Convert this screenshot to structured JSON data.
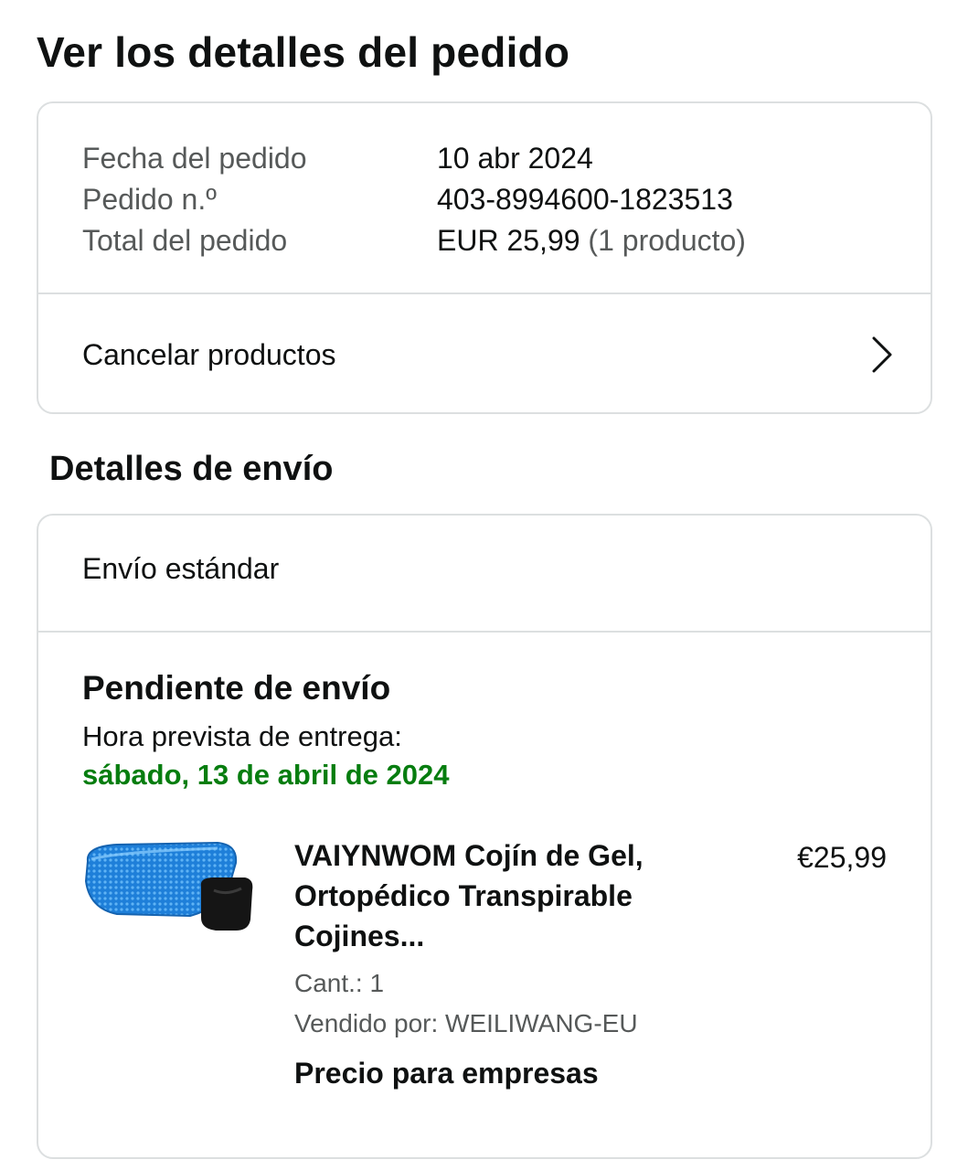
{
  "page_title": "Ver los detalles del pedido",
  "summary": {
    "rows": [
      {
        "label": "Fecha del pedido",
        "value": "10 abr 2024",
        "extra": ""
      },
      {
        "label": "Pedido n.º",
        "value": "403-8994600-1823513",
        "extra": ""
      },
      {
        "label": "Total del pedido",
        "value": "EUR 25,99",
        "extra": " (1 producto)"
      }
    ],
    "cancel_label": "Cancelar productos",
    "cancel_icon": "chevron-right-icon"
  },
  "shipping": {
    "section_title": "Detalles de envío",
    "method": "Envío estándar",
    "status": "Pendiente de envío",
    "eta_label": "Hora prevista de entrega:",
    "eta_date": "sábado, 13 de abril de 2024",
    "eta_color": "#067d0f",
    "product": {
      "title": "VAIYNWOM Cojín de Gel, Ortopédico Transpirable Cojines...",
      "price": "€25,99",
      "quantity": "Cant.: 1",
      "seller": "Vendido por: WEILIWANG-EU",
      "business_price": "Precio para empresas",
      "image_icon": "gel-seat-cushion-image"
    }
  }
}
